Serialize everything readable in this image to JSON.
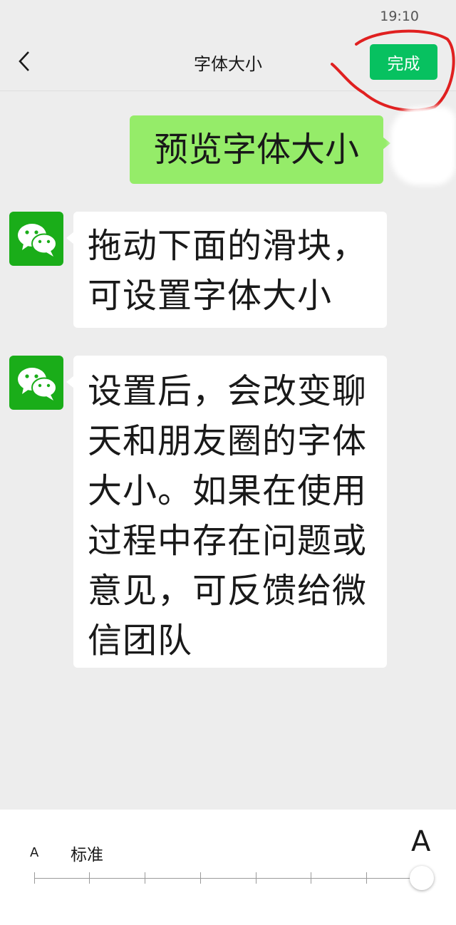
{
  "status_bar": {
    "time": "19:10"
  },
  "nav": {
    "back_icon": "chevron-left-icon",
    "title": "字体大小",
    "done_label": "完成"
  },
  "messages": [
    {
      "side": "right",
      "lines": [
        "预览字体大小"
      ]
    },
    {
      "side": "left",
      "lines": [
        "拖动下面的滑块，",
        "可设置字体大小"
      ]
    },
    {
      "side": "left",
      "lines": [
        "设置后，会改变聊",
        "天和朋友圈的字体",
        "大小。如果在使用",
        "过程中存在问题或",
        "意见，可反馈给微",
        "信团队"
      ]
    }
  ],
  "font_size_panel": {
    "small_label": "A",
    "standard_label": "标准",
    "large_label": "A",
    "levels": 8,
    "selected_level": 8
  },
  "colors": {
    "accent": "#07c160",
    "self_bubble": "#95ec69",
    "annotation": "#e02020"
  }
}
